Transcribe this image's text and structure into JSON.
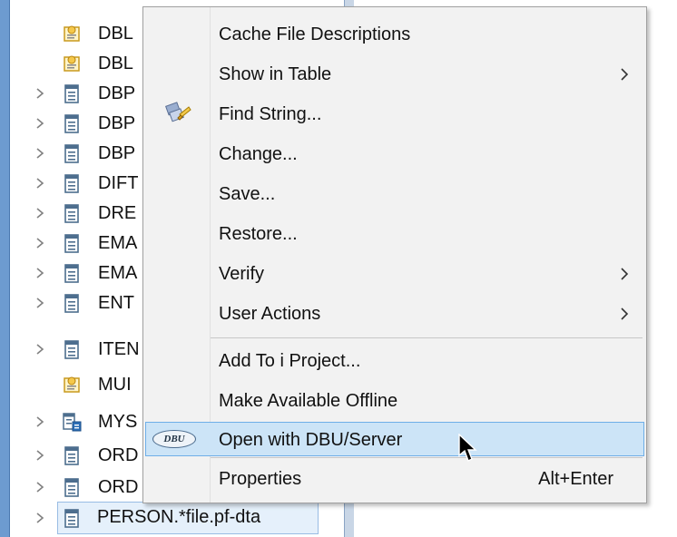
{
  "tree": {
    "items": [
      {
        "label": "DBL",
        "icon": "query-icon",
        "expandable": false
      },
      {
        "label": "DBL",
        "icon": "query-icon",
        "expandable": false
      },
      {
        "label": "DBP",
        "icon": "file-icon",
        "expandable": true
      },
      {
        "label": "DBP",
        "icon": "file-icon",
        "expandable": true
      },
      {
        "label": "DBP",
        "icon": "file-icon",
        "expandable": true
      },
      {
        "label": "DIFT",
        "icon": "file-icon",
        "expandable": true
      },
      {
        "label": "DRE",
        "icon": "file-icon",
        "expandable": true
      },
      {
        "label": "EMA",
        "icon": "file-icon",
        "expandable": true
      },
      {
        "label": "EMA",
        "icon": "file-icon",
        "expandable": true
      },
      {
        "label": "ENT",
        "icon": "file-icon",
        "expandable": true
      },
      {
        "label": "ITEN",
        "icon": "file-icon",
        "expandable": true
      },
      {
        "label": "MUI",
        "icon": "query-icon",
        "expandable": false
      },
      {
        "label": "MYS",
        "icon": "multi-file-icon",
        "expandable": true
      },
      {
        "label": "ORD",
        "icon": "file-icon",
        "expandable": true
      },
      {
        "label": "ORD",
        "icon": "file-icon",
        "expandable": true
      },
      {
        "label": "PERSON.*file.pf-dta",
        "icon": "file-icon",
        "expandable": true,
        "selected": true
      }
    ]
  },
  "menu": {
    "items": [
      {
        "label": "Cache File Descriptions"
      },
      {
        "label": "Show in Table",
        "submenu": true
      },
      {
        "label": "Find String...",
        "icon": "find-string-icon"
      },
      {
        "label": "Change..."
      },
      {
        "label": "Save..."
      },
      {
        "label": "Restore..."
      },
      {
        "label": "Verify",
        "submenu": true
      },
      {
        "label": "User Actions",
        "submenu": true
      },
      {
        "label": "Add To i Project..."
      },
      {
        "label": "Make Available Offline"
      },
      {
        "label": "Open with DBU/Server",
        "icon": "dbu-icon",
        "highlighted": true
      },
      {
        "label": "Properties",
        "shortcut": "Alt+Enter"
      }
    ],
    "dbu_logo_text": "DBU"
  },
  "colors": {
    "menu_bg": "#f2f2f2",
    "highlight_bg": "#cce4f7",
    "highlight_border": "#6eaee8",
    "tree_frame": "#6d9bd0"
  }
}
